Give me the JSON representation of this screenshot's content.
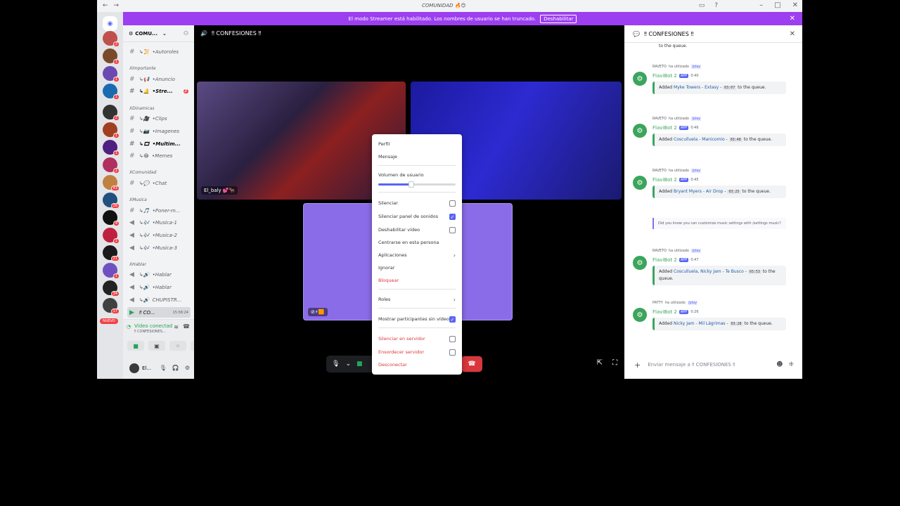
{
  "titlebar": {
    "title": "COMUNIDAD 🔥😊"
  },
  "banner": {
    "text": "El modo Streamer está habilitado. Los nombres de usuario se han truncado.",
    "button": "Deshabilitar"
  },
  "servers": {
    "badges": [
      "2",
      "1",
      "1",
      "1",
      "2",
      "1",
      "1",
      "1",
      "43",
      "26",
      "4",
      "1",
      "21",
      "1",
      "34",
      "17",
      "1"
    ],
    "new_label": "NUEVO"
  },
  "sidebar": {
    "server_name": "COMU...",
    "channels": [
      {
        "label": "•Autoroles",
        "prefix": "↳📜"
      },
      {
        "label": "•Anuncio",
        "prefix": "↳📢"
      },
      {
        "label": "•Stre...",
        "prefix": "↳🔔",
        "badge": "2"
      },
      {
        "label": "•Clips",
        "prefix": "↳🎥"
      },
      {
        "label": "•Imagenes",
        "prefix": "↳📷"
      },
      {
        "label": "•Multim...",
        "prefix": "↳🎞"
      },
      {
        "label": "•Memes",
        "prefix": "↳😂"
      },
      {
        "label": "•Chat",
        "prefix": "↳💬"
      },
      {
        "label": "•Poner-m...",
        "prefix": "↳🎵"
      },
      {
        "label": "•Musica-1",
        "prefix": "↳🎶"
      },
      {
        "label": "•Musica-2",
        "prefix": "↳🎶"
      },
      {
        "label": "•Musica-3",
        "prefix": "↳🎶"
      },
      {
        "label": "•Hablar",
        "prefix": "↳🔊"
      },
      {
        "label": "•Hablar",
        "prefix": "↳🔊"
      },
      {
        "label": "CHUPISTR...",
        "prefix": "↳🔊"
      },
      {
        "label": "‼ CO...",
        "time": "15:58:24"
      }
    ],
    "categories": [
      "XImportante",
      "XDinamicas",
      "XComunidad",
      "XMusica",
      "XHablar"
    ]
  },
  "voice": {
    "title": "Vídeo conectad",
    "sub": "‼ CONFESIONES..."
  },
  "user": {
    "name": "El..."
  },
  "stage": {
    "title": "‼ CONFESIONES ‼",
    "tile1_name": "El_baly 💕🐂"
  },
  "context_menu": {
    "profile": "Perfil",
    "message": "Mensaje",
    "volume_label": "Volumen de usuario",
    "volume_percent": 43,
    "mute": "Silenciar",
    "mute_soundboard": "Silenciar panel de sonidos",
    "disable_video": "Deshabilitar vídeo",
    "focus": "Centrarse en esta persona",
    "apps": "Aplicaciones",
    "ignore": "Ignorar",
    "block": "Bloquear",
    "roles": "Roles",
    "show_non_video": "Mostrar participantes sin vídeo",
    "server_mute": "Silenciar en servidor",
    "server_deafen": "Ensordecer servidor",
    "disconnect": "Desconectar"
  },
  "chat": {
    "title": "‼ CONFESIONES ‼",
    "top_fragment": "to the queue.",
    "messages": [
      {
        "user": "RAVETO",
        "used": "ha utilizado",
        "cmd": "/play",
        "bot": "FlaviBot 2",
        "app": "APP",
        "time": "0:40",
        "song": "Myke Towers - Extasy",
        "dur": "03:07",
        "tail": "to the queue."
      },
      {
        "user": "RAVETO",
        "used": "ha utilizado",
        "cmd": "/play",
        "bot": "FlaviBot 2",
        "app": "APP",
        "time": "0:46",
        "song": "Cosculluela - Manicomio",
        "dur": "03:48",
        "tail": "to the queue."
      },
      {
        "user": "RAVETO",
        "used": "ha utilizado",
        "cmd": "/play",
        "bot": "FlaviBot 2",
        "app": "APP",
        "time": "0:45",
        "song": "Bryant Myers - Air Drop",
        "dur": "03:25",
        "tail": "to the queue."
      },
      {
        "user": "RAVETO",
        "used": "ha utilizado",
        "cmd": "/play",
        "bot": "FlaviBot 2",
        "app": "APP",
        "time": "0:47",
        "song": "Cosculluela, Nicky Jam - Te Busco",
        "dur": "03:53",
        "tail": "to the queue."
      },
      {
        "user": "PATTY",
        "used": "ha utilizado",
        "cmd": "/play",
        "bot": "FlaviBot 2",
        "app": "APP",
        "time": "0:26",
        "song": "Nicky Jam - Mil Lágrimas",
        "dur": "03:28",
        "tail": "to the queue."
      }
    ],
    "added": "Added",
    "tip": "Did you know you can customize music settings with /settings music?",
    "input_placeholder": "Enviar mensaje a ‼ CONFESIONES ‼"
  }
}
